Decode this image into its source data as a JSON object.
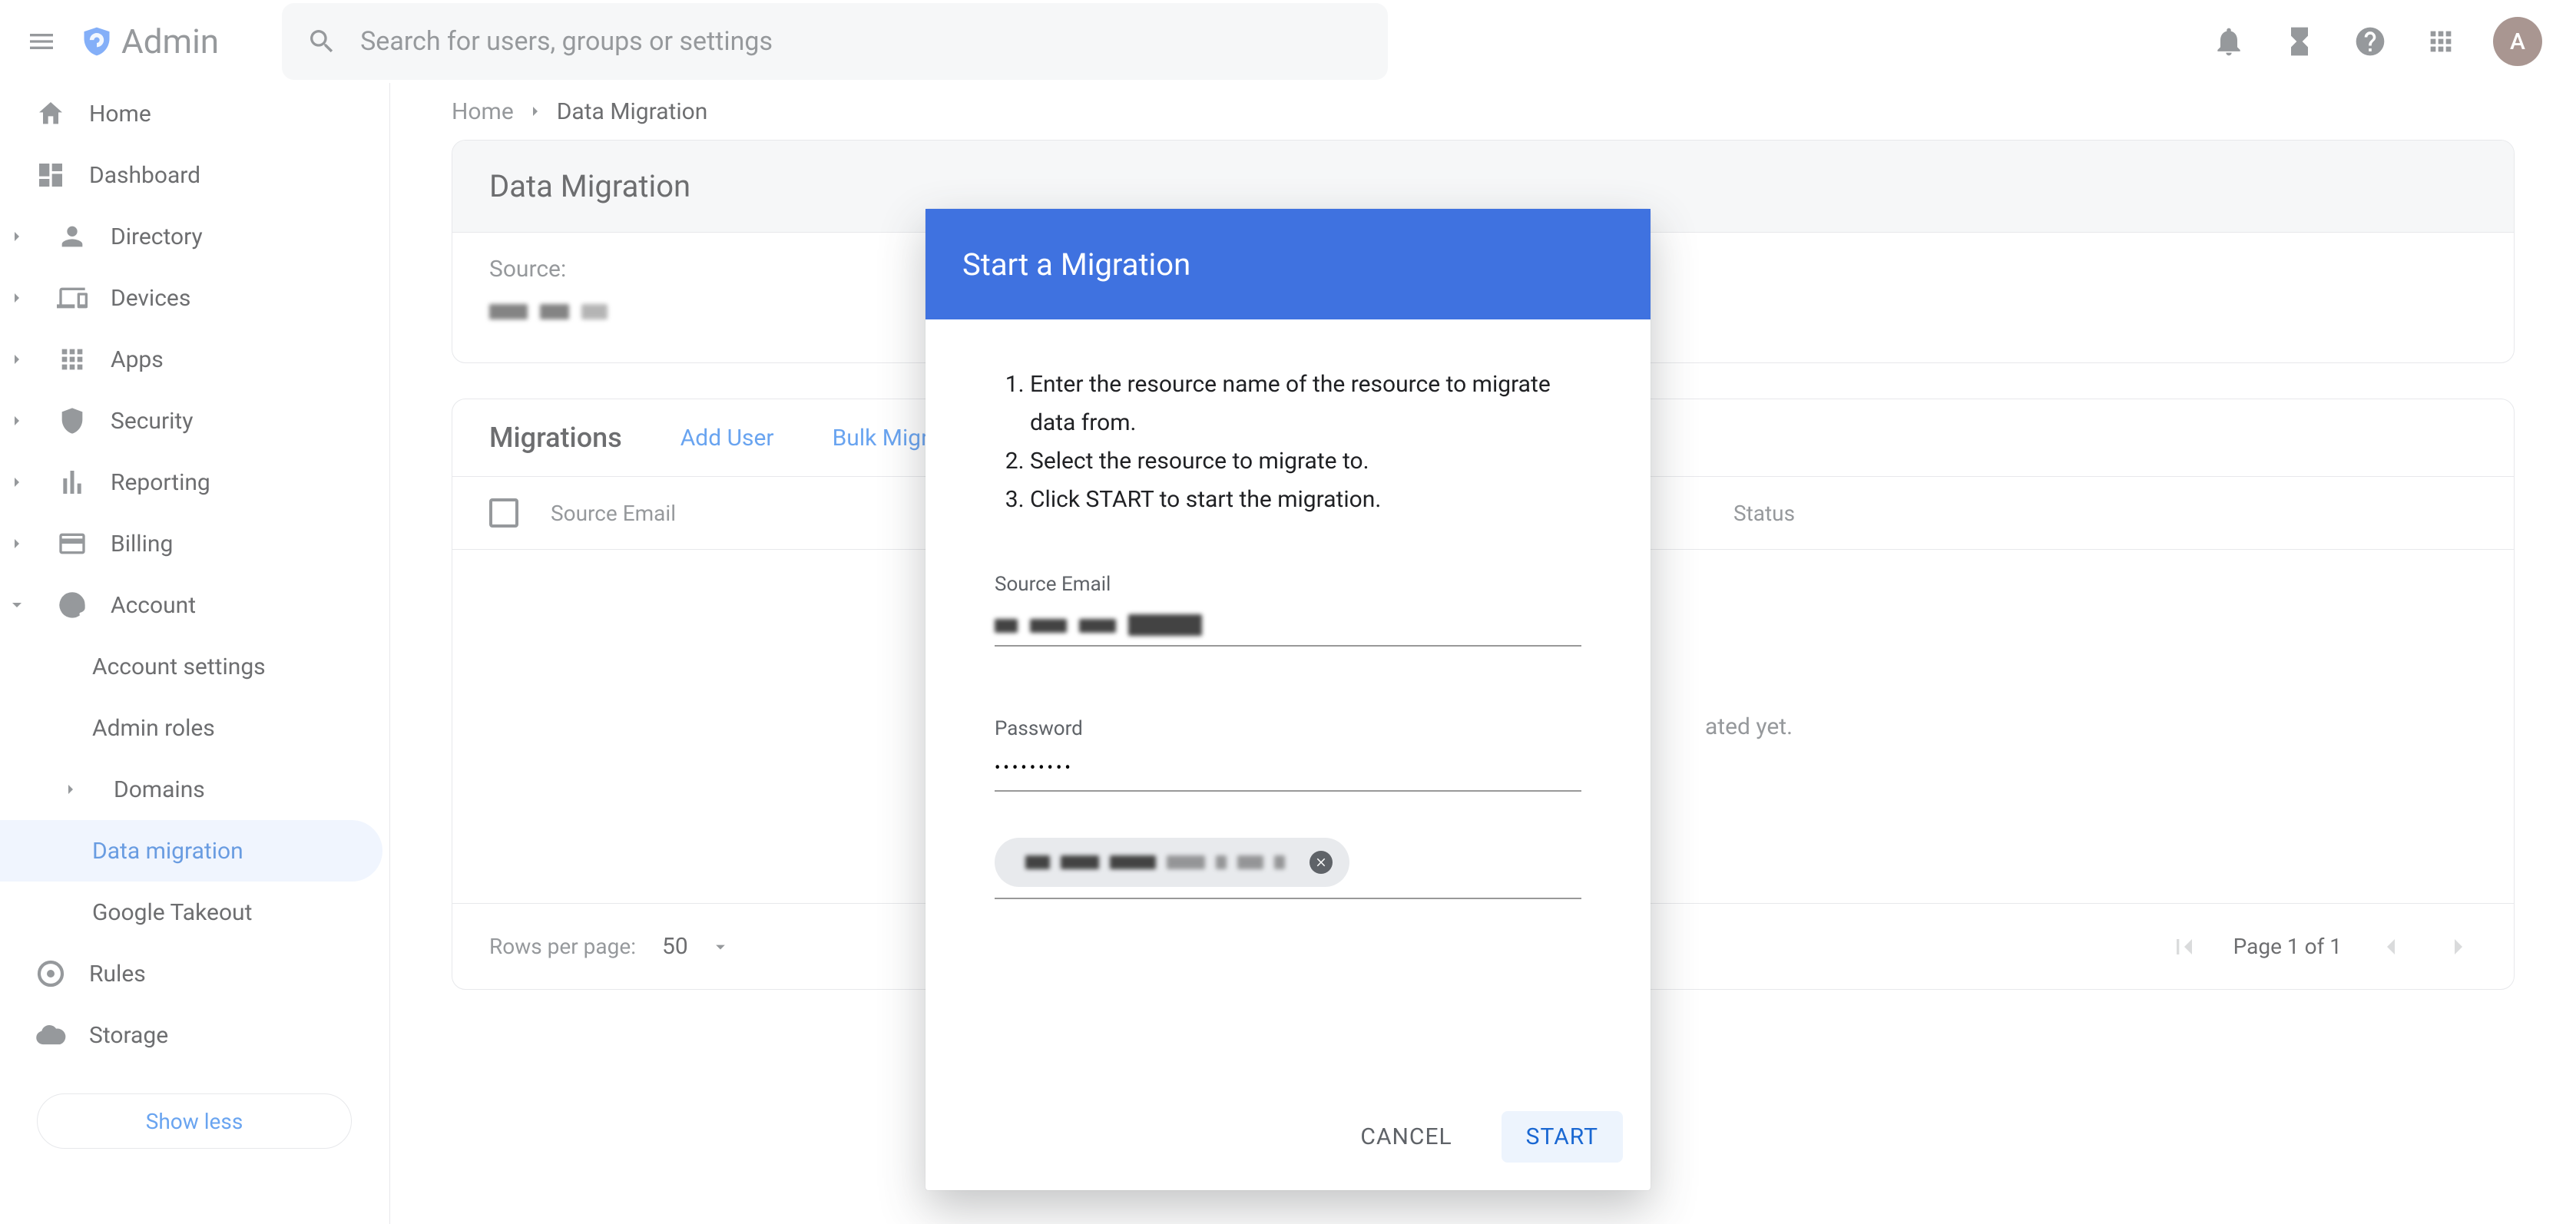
{
  "brand": {
    "name": "Admin"
  },
  "search": {
    "placeholder": "Search for users, groups or settings"
  },
  "avatar": {
    "initial": "A"
  },
  "nav": {
    "home": "Home",
    "dashboard": "Dashboard",
    "directory": "Directory",
    "devices": "Devices",
    "apps": "Apps",
    "security": "Security",
    "reporting": "Reporting",
    "billing": "Billing",
    "account": "Account",
    "account_settings": "Account settings",
    "admin_roles": "Admin roles",
    "domains": "Domains",
    "data_migration": "Data migration",
    "google_takeout": "Google Takeout",
    "rules": "Rules",
    "storage": "Storage",
    "show_less": "Show less"
  },
  "breadcrumb": {
    "home": "Home",
    "current": "Data Migration"
  },
  "page": {
    "title": "Data Migration",
    "source_label": "Source:"
  },
  "migrations": {
    "title": "Migrations",
    "add_user": "Add User",
    "bulk_migrate_prefix": "Bulk Migra",
    "columns": {
      "source_email": "Source Email",
      "status": "Status"
    },
    "empty_suffix": "ated yet."
  },
  "pagination": {
    "rows_label": "Rows per page:",
    "rows_value": "50",
    "page_indicator": "Page 1 of 1"
  },
  "dialog": {
    "title": "Start a Migration",
    "step1": "Enter the resource name of the resource to migrate data from.",
    "step2": "Select the resource to migrate to.",
    "step3": "Click START to start the migration.",
    "source_email_label": "Source Email",
    "password_label": "Password",
    "password_value": "•••••••••",
    "cancel": "CANCEL",
    "start": "START"
  }
}
